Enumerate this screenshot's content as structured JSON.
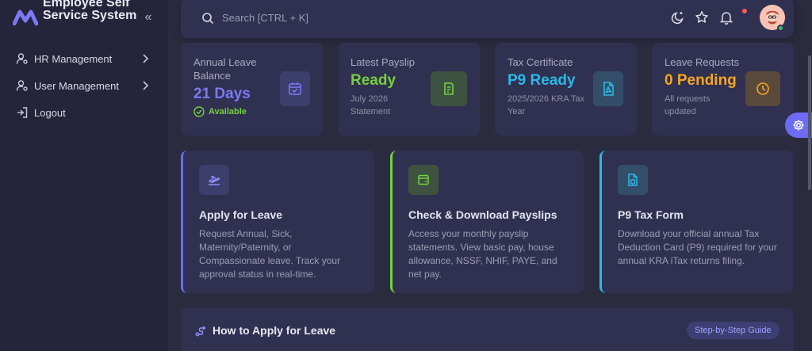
{
  "app": {
    "title": "Employee Self Service System",
    "accent": "#6d6bf2"
  },
  "sidebar": {
    "items": [
      {
        "label": "HR Management",
        "icon": "user-cog-icon"
      },
      {
        "label": "User Management",
        "icon": "user-cog-icon"
      },
      {
        "label": "Logout",
        "icon": "logout-icon"
      }
    ]
  },
  "search": {
    "placeholder": "Search [CTRL + K]"
  },
  "stats": [
    {
      "label": "Annual Leave Balance",
      "value": "21 Days",
      "sub": "Available",
      "color": "#7b79f7",
      "icon": "calendar-check-icon"
    },
    {
      "label": "Latest Payslip",
      "value": "Ready",
      "sub": "July 2026 Statement",
      "color": "#73d13d",
      "icon": "receipt-icon"
    },
    {
      "label": "Tax Certificate",
      "value": "P9 Ready",
      "sub": "2025/2026 KRA Tax Year",
      "color": "#2ab8e8",
      "icon": "pdf-file-icon"
    },
    {
      "label": "Leave Requests",
      "value": "0 Pending",
      "sub": "All requests updated",
      "color": "#f5a623",
      "icon": "clock-icon"
    }
  ],
  "cards": [
    {
      "title": "Apply for Leave",
      "desc": "Request Annual, Sick, Maternity/Paternity, or Compassionate leave. Track your approval status in real-time.",
      "color": "#6d6bf2",
      "icon": "plane-departure-icon"
    },
    {
      "title": "Check & Download Payslips",
      "desc": "Access your monthly payslip statements. View basic pay, house allowance, NSSF, NHIF, PAYE, and net pay.",
      "color": "#73d13d",
      "icon": "wallet-icon"
    },
    {
      "title": "P9 Tax Form",
      "desc": "Download your official annual Tax Deduction Card (P9) required for your annual KRA iTax returns filing.",
      "color": "#2ab8e8",
      "icon": "file-shield-icon"
    }
  ],
  "guide": {
    "title": "How to Apply for Leave",
    "badge": "Step-by-Step Guide"
  }
}
